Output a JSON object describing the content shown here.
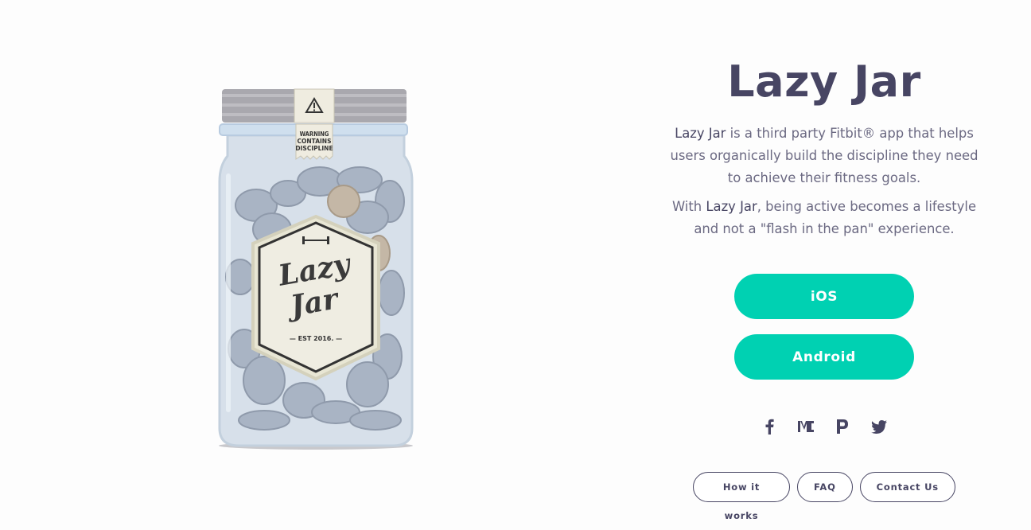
{
  "hero": {
    "jar_lid_text": "WARNING CONTAINS DISCIPLINE",
    "jar_label_line1": "Lazy",
    "jar_label_line2": "Jar",
    "jar_est": "EST 2016.",
    "icons": [
      "warning-icon",
      "dumbbell-icon"
    ]
  },
  "app": {
    "title": "Lazy Jar",
    "desc1_brand": "Lazy Jar",
    "desc1_rest": " is a third party Fitbit® app that helps users organically build the discipline they need to achieve their fitness goals.",
    "desc2_pre": "With ",
    "desc2_brand": "Lazy Jar",
    "desc2_rest": ", being active becomes a lifestyle and not a \"flash in the pan\" experience."
  },
  "buttons": {
    "ios": "iOS",
    "android": "Android"
  },
  "social": {
    "icons": [
      "facebook-icon",
      "medium-icon",
      "producthunt-icon",
      "twitter-icon"
    ]
  },
  "footer": {
    "how": "How it works",
    "faq": "FAQ",
    "contact": "Contact Us"
  },
  "colors": {
    "accent": "#00d1b2",
    "title": "#474563",
    "text": "#6b6982"
  }
}
